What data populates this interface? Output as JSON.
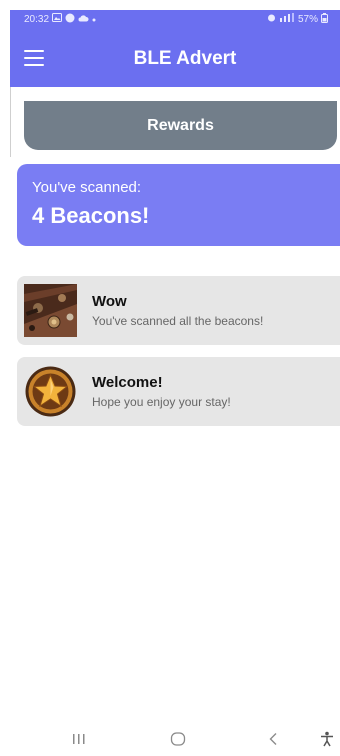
{
  "status_bar": {
    "time": "20:32",
    "right_text": "57%",
    "left_icons": [
      "gallery-icon",
      "message-icon",
      "cloud-icon",
      "dot-icon"
    ],
    "right_icons": [
      "alarm-icon",
      "signal-icon",
      "battery-icon"
    ]
  },
  "app_bar": {
    "title": "BLE Advert",
    "menu_icon": "menu-icon",
    "color": "#6b6ff0"
  },
  "tab": {
    "label": "Rewards",
    "color": "#727e8a"
  },
  "scan_summary": {
    "label": "You've scanned:",
    "count_text": "4 Beacons!",
    "color": "#7a7df3"
  },
  "rewards": [
    {
      "title": "Wow",
      "subtitle": "You've scanned all the beacons!",
      "icon": "board-game-icon"
    },
    {
      "title": "Welcome!",
      "subtitle": "Hope you enjoy your stay!",
      "icon": "star-medal-icon"
    }
  ],
  "nav_bar": {
    "buttons": [
      "recent-apps-icon",
      "home-icon",
      "back-icon",
      "accessibility-icon"
    ]
  }
}
